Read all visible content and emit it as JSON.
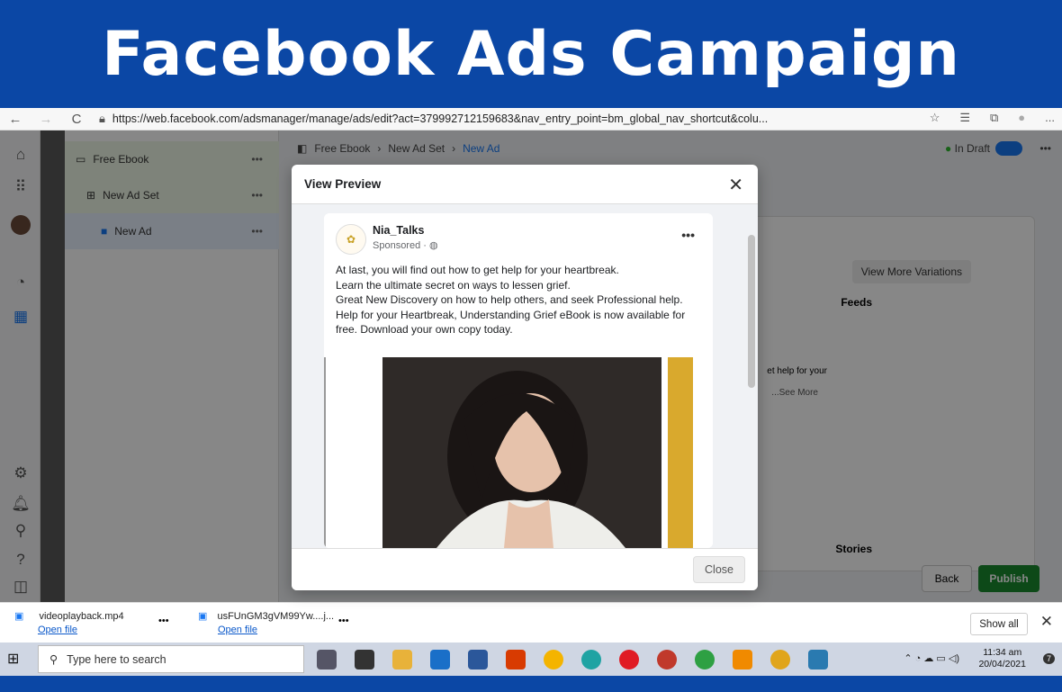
{
  "banner": {
    "title": "Facebook Ads Campaign"
  },
  "browser": {
    "url": "https://web.facebook.com/adsmanager/manage/ads/edit?act=379992712159683&nav_entry_point=bm_global_nav_shortcut&colu...",
    "nav": {
      "back": "←",
      "forward": "→",
      "refresh": "C"
    },
    "tools": [
      "☆",
      "☰",
      "⧉",
      "●",
      "..."
    ]
  },
  "tree": [
    {
      "label": "Free Ebook",
      "icon": "folder-icon"
    },
    {
      "label": "New Ad Set",
      "icon": "grid-icon"
    },
    {
      "label": "New Ad",
      "icon": "ad-icon"
    }
  ],
  "breadcrumb": {
    "items": [
      "Free Ebook",
      "New Ad Set",
      "New Ad"
    ]
  },
  "status": {
    "label": "In Draft",
    "color": "#2eb82e"
  },
  "background_panel": {
    "view_more": "View More Variations",
    "feeds": "Feeds",
    "stories": "Stories",
    "text_snippet": "et help for your",
    "see_more": "...See More",
    "back": "Back",
    "publish": "Publish",
    "publish_color": "#1a8a2f"
  },
  "modal": {
    "title": "View Preview",
    "close_label": "Close",
    "post": {
      "page_name": "Nia_Talks",
      "sponsored": "Sponsored · ",
      "text_lines": [
        "At last, you will find out how to get help for your heartbreak.",
        "Learn the ultimate secret on ways to lessen grief.",
        "Great New Discovery on how to help others, and seek Professional help.",
        "Help for your Heartbreak, Understanding Grief eBook is now available for free. Download your own copy today."
      ],
      "accent_color": "#d9a92d"
    }
  },
  "downloads": {
    "items": [
      {
        "name": "videoplayback.mp4",
        "action": "Open file"
      },
      {
        "name": "usFUnGM3gVM99Yw....j...",
        "action": "Open file"
      }
    ],
    "show_all": "Show all"
  },
  "taskbar": {
    "search_placeholder": "Type here to search",
    "time": "11:34 am",
    "date": "20/04/2021",
    "notifications": "7"
  }
}
